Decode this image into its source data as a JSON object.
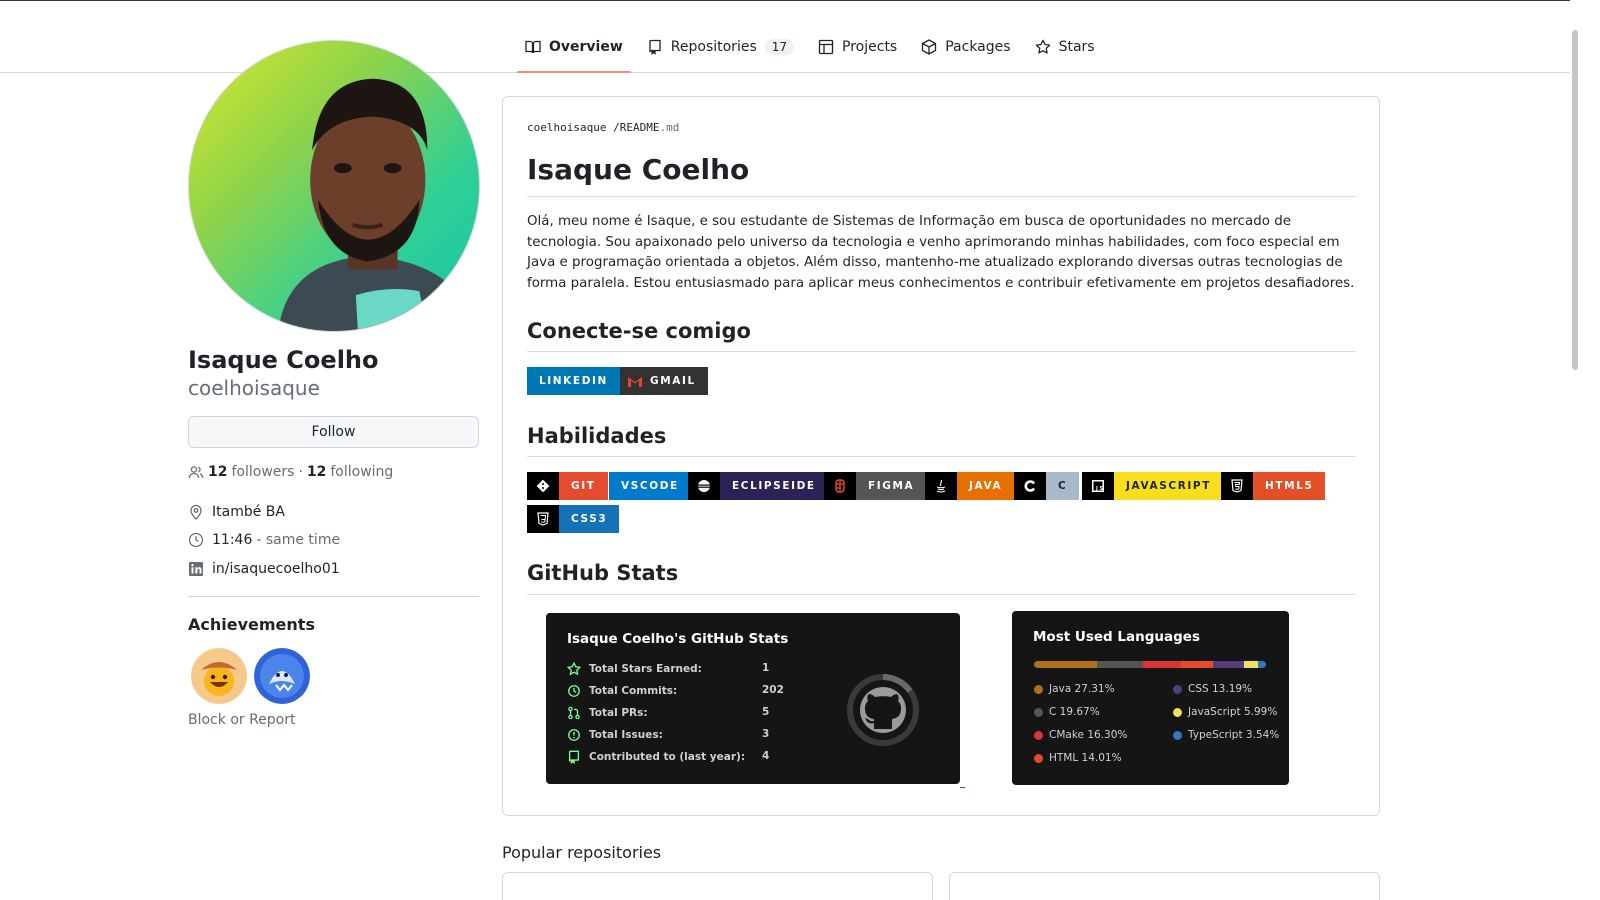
{
  "tabs": [
    {
      "label": "Overview",
      "icon": "book-icon",
      "active": true
    },
    {
      "label": "Repositories",
      "icon": "repo-icon",
      "count": "17"
    },
    {
      "label": "Projects",
      "icon": "table-icon"
    },
    {
      "label": "Packages",
      "icon": "package-icon"
    },
    {
      "label": "Stars",
      "icon": "star-icon"
    }
  ],
  "profile": {
    "name": "Isaque Coelho",
    "login": "coelhoisaque",
    "follow_label": "Follow",
    "followers_count": "12",
    "followers_label": "followers",
    "dot": "·",
    "following_count": "12",
    "following_label": "following",
    "location": "Itambé BA",
    "time": "11:46",
    "time_note": "- same time",
    "linkedin": "in/isaquecoelho01",
    "achievements_title": "Achievements",
    "block_report": "Block or Report"
  },
  "readme": {
    "crumb_user": "coelhoisaque",
    "crumb_sep": "/",
    "crumb_file": "README",
    "crumb_ext": ".md",
    "title": "Isaque Coelho",
    "intro": "Olá, meu nome é Isaque, e sou estudante de Sistemas de Informação em busca de oportunidades no mercado de tecnologia. Sou apaixonado pelo universo da tecnologia e venho aprimorando minhas habilidades, com foco especial em Java e programação orientada a objetos. Além disso, mantenho-me atualizado explorando diversas outras tecnologias de forma paralela. Estou entusiasmado para aplicar meus conhecimentos e contribuir efetivamente em projetos desafiadores.",
    "connect_heading": "Conecte-se comigo",
    "connect_badges": [
      {
        "label": "LINKEDIN",
        "color": "#0077b5"
      },
      {
        "label": "GMAIL",
        "color": "#333333"
      }
    ],
    "skills_heading": "Habilidades",
    "skills": [
      {
        "label": "GIT",
        "color": "#e44c30"
      },
      {
        "label": "VSCODE",
        "color": "#007acc"
      },
      {
        "label": "ECLIPSEIDE",
        "color": "#2c2255"
      },
      {
        "label": "FIGMA",
        "color": "#555555"
      },
      {
        "label": "JAVA",
        "color": "#e76f00"
      },
      {
        "label": "C",
        "color": "#a8b9cc"
      },
      {
        "label": "JAVASCRIPT",
        "color": "#f7df1e"
      },
      {
        "label": "HTML5",
        "color": "#e34f26"
      },
      {
        "label": "CSS3",
        "color": "#1572b6"
      }
    ],
    "stats_heading": "GitHub Stats"
  },
  "stats_card": {
    "title": "Isaque Coelho's GitHub Stats",
    "rows": [
      {
        "label": "Total Stars Earned:",
        "value": "1",
        "icon": "star-icon"
      },
      {
        "label": "Total Commits:",
        "value": "202",
        "icon": "history-icon"
      },
      {
        "label": "Total PRs:",
        "value": "5",
        "icon": "pull-request-icon"
      },
      {
        "label": "Total Issues:",
        "value": "3",
        "icon": "issue-icon"
      },
      {
        "label": "Contributed to (last year):",
        "value": "4",
        "icon": "repo-icon"
      }
    ]
  },
  "languages_card": {
    "title": "Most Used Languages",
    "languages": [
      {
        "name": "Java",
        "percent": "27.31%",
        "value": 27.31,
        "color": "#b07219"
      },
      {
        "name": "C",
        "percent": "19.67%",
        "value": 19.67,
        "color": "#555555"
      },
      {
        "name": "CMake",
        "percent": "16.30%",
        "value": 16.3,
        "color": "#da3434"
      },
      {
        "name": "HTML",
        "percent": "14.01%",
        "value": 14.01,
        "color": "#e34c26"
      },
      {
        "name": "CSS",
        "percent": "13.19%",
        "value": 13.19,
        "color": "#563d7c"
      },
      {
        "name": "JavaScript",
        "percent": "5.99%",
        "value": 5.99,
        "color": "#f1e05a"
      },
      {
        "name": "TypeScript",
        "percent": "3.54%",
        "value": 3.54,
        "color": "#3178c6"
      }
    ]
  },
  "popular_title": "Popular repositories"
}
